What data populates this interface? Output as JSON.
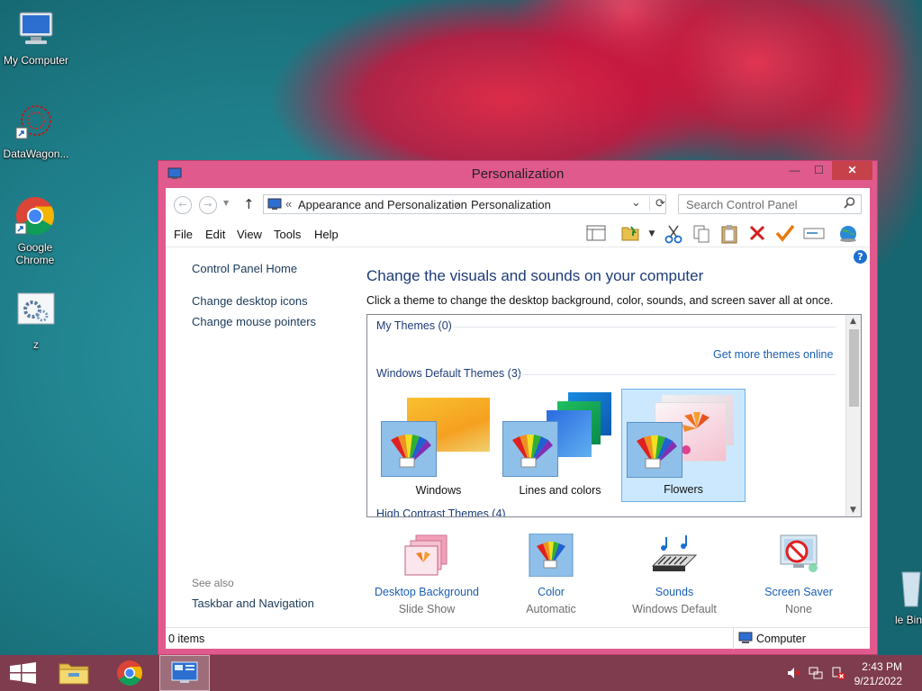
{
  "desktop": {
    "icons": [
      {
        "label": "My Computer"
      },
      {
        "label": "DataWagon..."
      },
      {
        "label": "Google Chrome"
      },
      {
        "label": "z"
      },
      {
        "label": "le Bin"
      }
    ]
  },
  "window": {
    "title": "Personalization",
    "controls": {
      "minimize": "—",
      "maximize": "☐",
      "close": "✕"
    },
    "address": {
      "prefix": "«",
      "crumb1": "Appearance and Personalization",
      "separator": "›",
      "crumb2": "Personalization",
      "dropdown": "⌄",
      "refresh": "⟳"
    },
    "search": {
      "placeholder": "Search Control Panel",
      "icon": "search-icon"
    },
    "menu": [
      "File",
      "Edit",
      "View",
      "Tools",
      "Help"
    ],
    "left_pane": {
      "home": "Control Panel Home",
      "links": [
        "Change desktop icons",
        "Change mouse pointers"
      ],
      "see_also_label": "See also",
      "see_also_links": [
        "Taskbar and Navigation"
      ]
    },
    "main": {
      "heading": "Change the visuals and sounds on your computer",
      "description": "Click a theme to change the desktop background, color, sounds, and screen saver all at once.",
      "my_themes_title": "My Themes (0)",
      "get_more": "Get more themes online",
      "default_title": "Windows Default Themes (3)",
      "themes": [
        {
          "name": "Windows",
          "selected": false
        },
        {
          "name": "Lines and colors",
          "selected": false
        },
        {
          "name": "Flowers",
          "selected": true
        }
      ],
      "cutoff_title": "High Contrast Themes (4)"
    },
    "settings": [
      {
        "name": "Desktop Background",
        "value": "Slide Show",
        "icon": "desktop-background-icon"
      },
      {
        "name": "Color",
        "value": "Automatic",
        "icon": "color-icon"
      },
      {
        "name": "Sounds",
        "value": "Windows Default",
        "icon": "sounds-icon"
      },
      {
        "name": "Screen Saver",
        "value": "None",
        "icon": "screen-saver-icon"
      }
    ],
    "status": {
      "items": "0 items",
      "location": "Computer"
    }
  },
  "taskbar": {
    "time": "2:43 PM",
    "date": "9/21/2022"
  },
  "colors": {
    "window_frame": "#e05a8e",
    "close_button": "#c7414b",
    "link_blue": "#1a5fb4",
    "heading_blue": "#1e3c78",
    "taskbar": "#7e3c4e"
  }
}
